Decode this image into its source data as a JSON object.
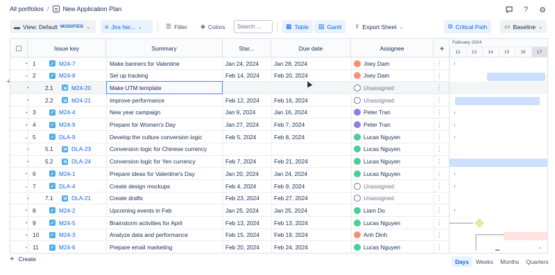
{
  "breadcrumb": {
    "portfolios": "All portfolios",
    "separator": "/",
    "plan": "New Application Plan"
  },
  "top_icons": [
    "feedback-icon",
    "help-icon",
    "settings-icon"
  ],
  "toolbar": {
    "view_label": "View: Default",
    "view_badge": "MODIFIED",
    "hierarchy_label": "Jira hie...",
    "filter_label": "Filter",
    "colors_label": "Colors",
    "search_placeholder": "Search ...",
    "table_label": "Table",
    "gantt_label": "Gantt",
    "export_label": "Export Sheet",
    "critical_path_label": "Critical Path",
    "baseline_label": "Baseline"
  },
  "table": {
    "headers": {
      "issue_key": "Issue key",
      "summary": "Summary",
      "start": "Star...",
      "due": "Due date",
      "assignee": "Assignee",
      "add": "+"
    },
    "rows": [
      {
        "num": "1",
        "toggle": "•",
        "level": 0,
        "key": "M24-7",
        "summary": "Make banners for Valentine",
        "start": "Jan 24, 2024",
        "due": "Jan 28, 2024",
        "assignee": "Joey Dam",
        "assigned": true
      },
      {
        "num": "2",
        "toggle": "⌄",
        "level": 0,
        "key": "M24-8",
        "summary": "Set up tracking",
        "start": "Feb 14, 2024",
        "due": "Feb 20, 2024",
        "assignee": "Joey Dam",
        "assigned": true
      },
      {
        "num": "2.1",
        "toggle": "•",
        "level": 1,
        "key": "M24-20",
        "summary": "Make UTM template",
        "start": "",
        "due": "",
        "assignee": "Unassigned",
        "assigned": false
      },
      {
        "num": "2.2",
        "toggle": "•",
        "level": 1,
        "key": "M24-21",
        "summary": "Improve performance",
        "start": "Feb 12, 2024",
        "due": "Feb 16, 2024",
        "assignee": "Unassigned",
        "assigned": false
      },
      {
        "num": "3",
        "toggle": "•",
        "level": 0,
        "key": "M24-4",
        "summary": "New year campaign",
        "start": "Jan 9, 2024",
        "due": "Jan 16, 2024",
        "assignee": "Peter Tran",
        "assigned": true
      },
      {
        "num": "4",
        "toggle": "•",
        "level": 0,
        "key": "M24-9",
        "summary": "Prepare for Women's Day",
        "start": "Jan 27, 2024",
        "due": "Feb 7, 2024",
        "assignee": "Peter Tran",
        "assigned": true
      },
      {
        "num": "5",
        "toggle": "⌄",
        "level": 0,
        "key": "DLA-9",
        "summary": "Develop the culture conversion logic",
        "start": "Feb 5, 2024",
        "due": "Feb 8, 2024",
        "assignee": "Lucas Nguyen",
        "assigned": true
      },
      {
        "num": "5.1",
        "toggle": "•",
        "level": 1,
        "key": "DLA-23",
        "summary": "Conversion logic for Chinese currency",
        "start": "",
        "due": "",
        "assignee": "Lucas Nguyen",
        "assigned": true
      },
      {
        "num": "5.2",
        "toggle": "•",
        "level": 1,
        "key": "DLA-24",
        "summary": "Conversion logic for Yen currency",
        "start": "Feb 7, 2024",
        "due": "Feb 21, 2024",
        "assignee": "Lucas Nguyen",
        "assigned": true
      },
      {
        "num": "6",
        "toggle": "•",
        "level": 0,
        "key": "M24-1",
        "summary": "Prepare ideas for Valentine's Day",
        "start": "Jan 20, 2024",
        "due": "Jan 24, 2024",
        "assignee": "Lucas Nguyen",
        "assigned": true
      },
      {
        "num": "7",
        "toggle": "⌄",
        "level": 0,
        "key": "DLA-4",
        "summary": "Create design mockups",
        "start": "Feb 4, 2024",
        "due": "Feb 9, 2024",
        "assignee": "Unassigned",
        "assigned": false
      },
      {
        "num": "7.1",
        "toggle": "•",
        "level": 1,
        "key": "DLA-21",
        "summary": "Create drafts",
        "start": "Feb 23, 2024",
        "due": "Feb 27, 2024",
        "assignee": "Unassigned",
        "assigned": false
      },
      {
        "num": "8",
        "toggle": "•",
        "level": 0,
        "key": "M24-2",
        "summary": "Upcoming events in Feb",
        "start": "Jan 25, 2024",
        "due": "Jan 25, 2024",
        "assignee": "Liam Do",
        "assigned": true
      },
      {
        "num": "9",
        "toggle": "•",
        "level": 0,
        "key": "M24-5",
        "summary": "Brainstorm activities for April",
        "start": "Feb 13, 2024",
        "due": "Feb 13, 2024",
        "assignee": "Lucas Nguyen",
        "assigned": true
      },
      {
        "num": "10",
        "toggle": "•",
        "level": 0,
        "key": "M24-3",
        "summary": "Analyze data and performance",
        "start": "Feb 15, 2024",
        "due": "Feb 19, 2024",
        "assignee": "Anh Dinh",
        "assigned": true
      },
      {
        "num": "11",
        "toggle": "•",
        "level": 0,
        "key": "M24-6",
        "summary": "Prepare email marketing",
        "start": "Feb 20, 2024",
        "due": "Feb 24, 2024",
        "assignee": "Lucas Nguyen",
        "assigned": true
      }
    ],
    "create_label": "Create"
  },
  "gantt": {
    "month": "February 2024",
    "days": [
      "12",
      "13",
      "14",
      "15",
      "16",
      "17"
    ],
    "today_day": "17",
    "zoom_options": [
      "Days",
      "Weeks",
      "Months",
      "Quarters"
    ],
    "zoom_active": "Days",
    "row_marks": [
      "left-arrow",
      "bar",
      "selected",
      "bar",
      "left-arrow",
      "left-arrow",
      "left-arrow",
      "none",
      "bar",
      "left-arrow",
      "left-arrow",
      "none",
      "left-arrow",
      "milestone",
      "bar-red",
      "right-arrow"
    ]
  },
  "colors": {
    "accent": "#0c66e4",
    "bar": "#cce0ff",
    "bar_red": "#ffe2e0",
    "milestone": "#d3f1a7"
  }
}
